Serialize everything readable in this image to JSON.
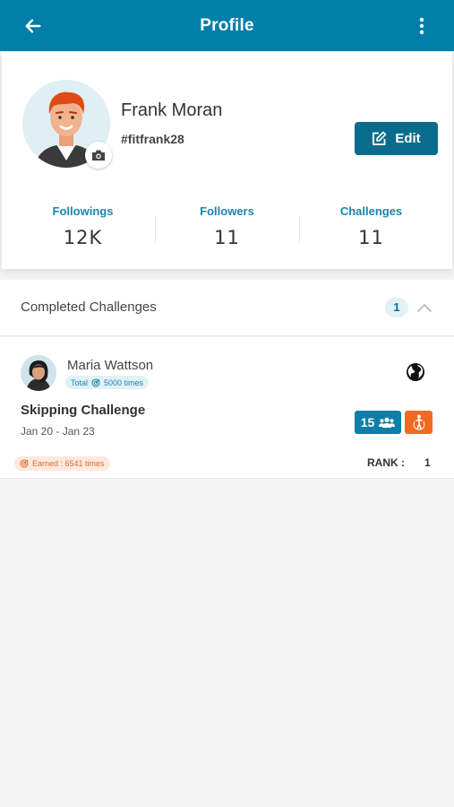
{
  "header": {
    "title": "Profile",
    "back_icon": "arrow-left-icon",
    "menu_icon": "more-vertical-icon",
    "bg_color": "#007eaa"
  },
  "profile": {
    "name": "Frank Moran",
    "handle": "#fitfrank28",
    "edit_label": "Edit",
    "camera_icon": "camera-icon",
    "stats": [
      {
        "label": "Followings",
        "value": "12K"
      },
      {
        "label": "Followers",
        "value": "11"
      },
      {
        "label": "Challenges",
        "value": "11"
      }
    ]
  },
  "completed": {
    "label": "Completed Challenges",
    "count": "1",
    "toggle_icon": "chevron-up-icon"
  },
  "challenge": {
    "user_name": "Maria Wattson",
    "total_label": "Total",
    "total_value": "5000 times",
    "title": "Skipping Challenge",
    "dates": "Jan 20 - Jan 23",
    "participants": "15",
    "earned": "Earned : 6541 times",
    "rank_label": "RANK :",
    "rank_value": "1",
    "visibility_icon": "globe-icon",
    "participants_icon": "group-icon",
    "activity_icon": "skipping-icon",
    "accent_blue": "#0a7fa8",
    "accent_orange": "#f06a22"
  }
}
